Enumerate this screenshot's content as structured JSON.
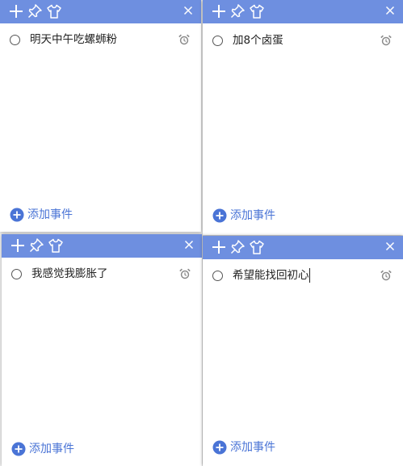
{
  "colors": {
    "titlebar": "#6e8fe0",
    "accent": "#4a74d6",
    "alarm": "#8a8a8a"
  },
  "icons": {
    "add": "plus-icon",
    "pin": "pin-icon",
    "skin": "shirt-icon",
    "close": "close-icon",
    "alarm": "alarm-clock-icon",
    "add_event": "plus-circle-icon"
  },
  "notes": [
    {
      "task": "明天中午吃螺蛳粉",
      "add_label": "添加事件"
    },
    {
      "task": "加8个卤蛋",
      "add_label": "添加事件"
    },
    {
      "task": "我感觉我膨胀了",
      "add_label": "添加事件"
    },
    {
      "task": "希望能找回初心",
      "add_label": "添加事件",
      "editing": true
    }
  ]
}
